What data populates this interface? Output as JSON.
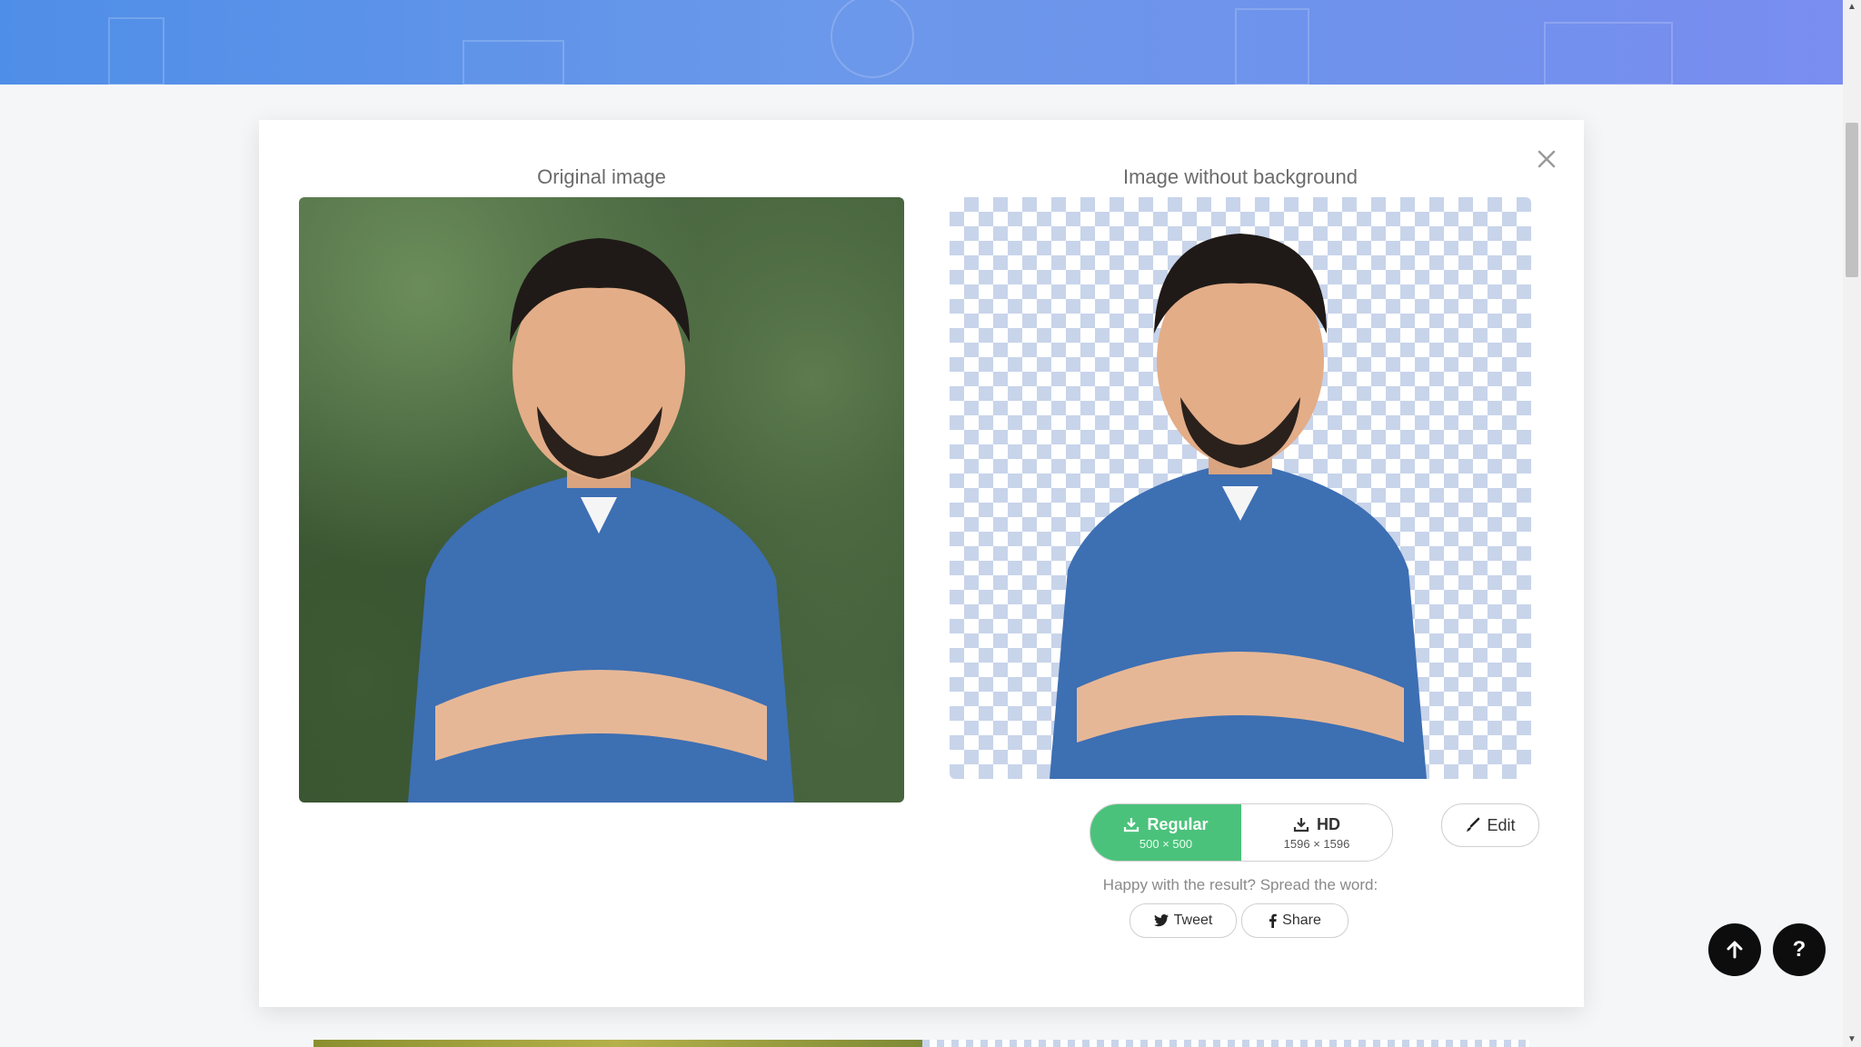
{
  "modal": {
    "left_title": "Original image",
    "right_title": "Image without background",
    "close_icon": "close-icon"
  },
  "downloads": {
    "regular": {
      "label": "Regular",
      "size": "500 × 500"
    },
    "hd": {
      "label": "HD",
      "size": "1596 × 1596"
    }
  },
  "edit": {
    "label": "Edit"
  },
  "share": {
    "prompt": "Happy with the result? Spread the word:",
    "tweet": "Tweet",
    "share": "Share"
  },
  "fab": {
    "help": "?"
  },
  "colors": {
    "accent_green": "#4bc27b",
    "banner_blue": "#5f95ea",
    "checker": "#c8d4ea"
  }
}
